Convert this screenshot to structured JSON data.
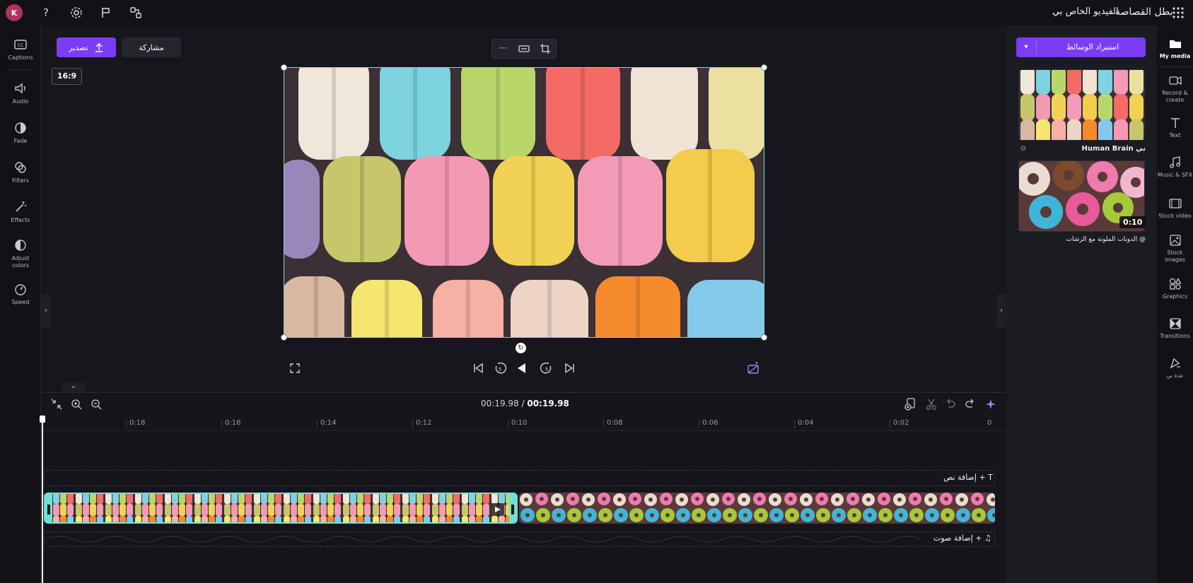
{
  "topbar": {
    "avatar_initial": "K",
    "project_title": "بطل القصاصة",
    "video_name": "الفيديو الخاص بي",
    "help_label": "?"
  },
  "left_rail": [
    {
      "name": "captions",
      "label": "Captions",
      "icon": "captions-icon"
    },
    {
      "name": "audio",
      "label": "Audio",
      "icon": "audio-icon"
    },
    {
      "name": "fade",
      "label": "Fade",
      "icon": "fade-icon"
    },
    {
      "name": "filters",
      "label": "Filters",
      "icon": "filters-icon"
    },
    {
      "name": "effects",
      "label": "Effects",
      "icon": "effects-icon"
    },
    {
      "name": "adjust-colors",
      "label": "Adjust colors",
      "icon": "adjust-colors-icon"
    },
    {
      "name": "speed",
      "label": "Speed",
      "icon": "speed-icon"
    }
  ],
  "right_rail": [
    {
      "name": "my-media",
      "label": "My media",
      "icon": "folder-icon",
      "active": true
    },
    {
      "name": "record-create",
      "label": "Record & create",
      "icon": "record-icon"
    },
    {
      "name": "text",
      "label": "Text",
      "icon": "text-icon"
    },
    {
      "name": "music-sfx",
      "label": "Music & SFX",
      "icon": "music-icon"
    },
    {
      "name": "stock-video",
      "label": "Stock video",
      "icon": "film-icon"
    },
    {
      "name": "stock-images",
      "label": "Stock images",
      "icon": "image-icon"
    },
    {
      "name": "graphics",
      "label": "Graphics",
      "icon": "shapes-icon"
    },
    {
      "name": "transitions",
      "label": "Transitions",
      "icon": "transitions-icon"
    },
    {
      "name": "brand-kit",
      "label": "عدة ني",
      "icon": "brand-icon"
    }
  ],
  "media_panel": {
    "import_label": "استيراد الوسائط",
    "items": [
      {
        "caption": "Human Brain ني",
        "duration": ""
      },
      {
        "caption": "الدونات الملونة مع الرشات @",
        "duration": "0:10"
      }
    ]
  },
  "preview": {
    "export_label": "تصدير",
    "share_label": "مشاركة",
    "aspect_ratio": "16:9"
  },
  "timeline": {
    "current_time": "00:19.98",
    "total_time": "00:19.98",
    "ruler_ticks": [
      "0",
      "0:02",
      "0:04",
      "0:06",
      "0:08",
      "0:10",
      "0:12",
      "0:14",
      "0:16",
      "0:18"
    ],
    "add_text_label": "إضافة نص",
    "add_audio_label": "إضافة صوت",
    "text_lane_icon": "T",
    "audio_lane_icon": "♫"
  },
  "colors": {
    "accent": "#7a3df5",
    "selection": "#6fe0d6",
    "background": "#16161c"
  }
}
